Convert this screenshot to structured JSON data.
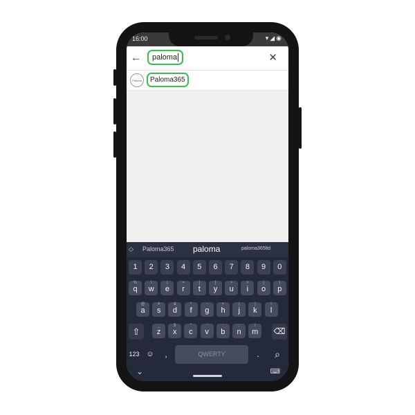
{
  "status_bar": {
    "time": "16:00",
    "icons": "▾◢◉"
  },
  "search": {
    "back_icon": "←",
    "query": "paloma",
    "clear_icon": "✕"
  },
  "results": [
    {
      "label": "Paloma365",
      "avatar_text": "Paloma"
    }
  ],
  "keyboard": {
    "suggestions": {
      "left": "Paloma365",
      "center": "paloma",
      "right": "paloma365ltd",
      "expand_icon": "◇"
    },
    "number_row": [
      "1",
      "2",
      "3",
      "4",
      "5",
      "6",
      "7",
      "8",
      "9",
      "0"
    ],
    "row1": [
      {
        "k": "q",
        "alt": "%"
      },
      {
        "k": "w",
        "alt": "\\"
      },
      {
        "k": "e",
        "alt": "|"
      },
      {
        "k": "r",
        "alt": "="
      },
      {
        "k": "t",
        "alt": "["
      },
      {
        "k": "y",
        "alt": "]"
      },
      {
        "k": "u",
        "alt": "<"
      },
      {
        "k": "i",
        "alt": ">"
      },
      {
        "k": "o",
        "alt": "{"
      },
      {
        "k": "p",
        "alt": "}"
      }
    ],
    "row2": [
      {
        "k": "a",
        "alt": "@"
      },
      {
        "k": "s",
        "alt": "#"
      },
      {
        "k": "d",
        "alt": "&"
      },
      {
        "k": "f",
        "alt": "*"
      },
      {
        "k": "g",
        "alt": "-"
      },
      {
        "k": "h",
        "alt": "+"
      },
      {
        "k": "j",
        "alt": "("
      },
      {
        "k": "k",
        "alt": ")"
      },
      {
        "k": "l",
        "alt": "l"
      }
    ],
    "row3": [
      {
        "k": "z",
        "alt": "_"
      },
      {
        "k": "x",
        "alt": "$"
      },
      {
        "k": "c",
        "alt": "\""
      },
      {
        "k": "v",
        "alt": "'"
      },
      {
        "k": "b",
        "alt": ":"
      },
      {
        "k": "n",
        "alt": ";"
      },
      {
        "k": "m",
        "alt": "/"
      }
    ],
    "shift_icon": "⇧",
    "backspace_icon": "⌫",
    "symbols_label": "123",
    "emoji_icon": "☺",
    "comma": ",",
    "space_label": "QWERTY",
    "period": ".",
    "search_icon": "⌕",
    "hide_icon": "⌄",
    "keyboard_icon": "⌨"
  }
}
